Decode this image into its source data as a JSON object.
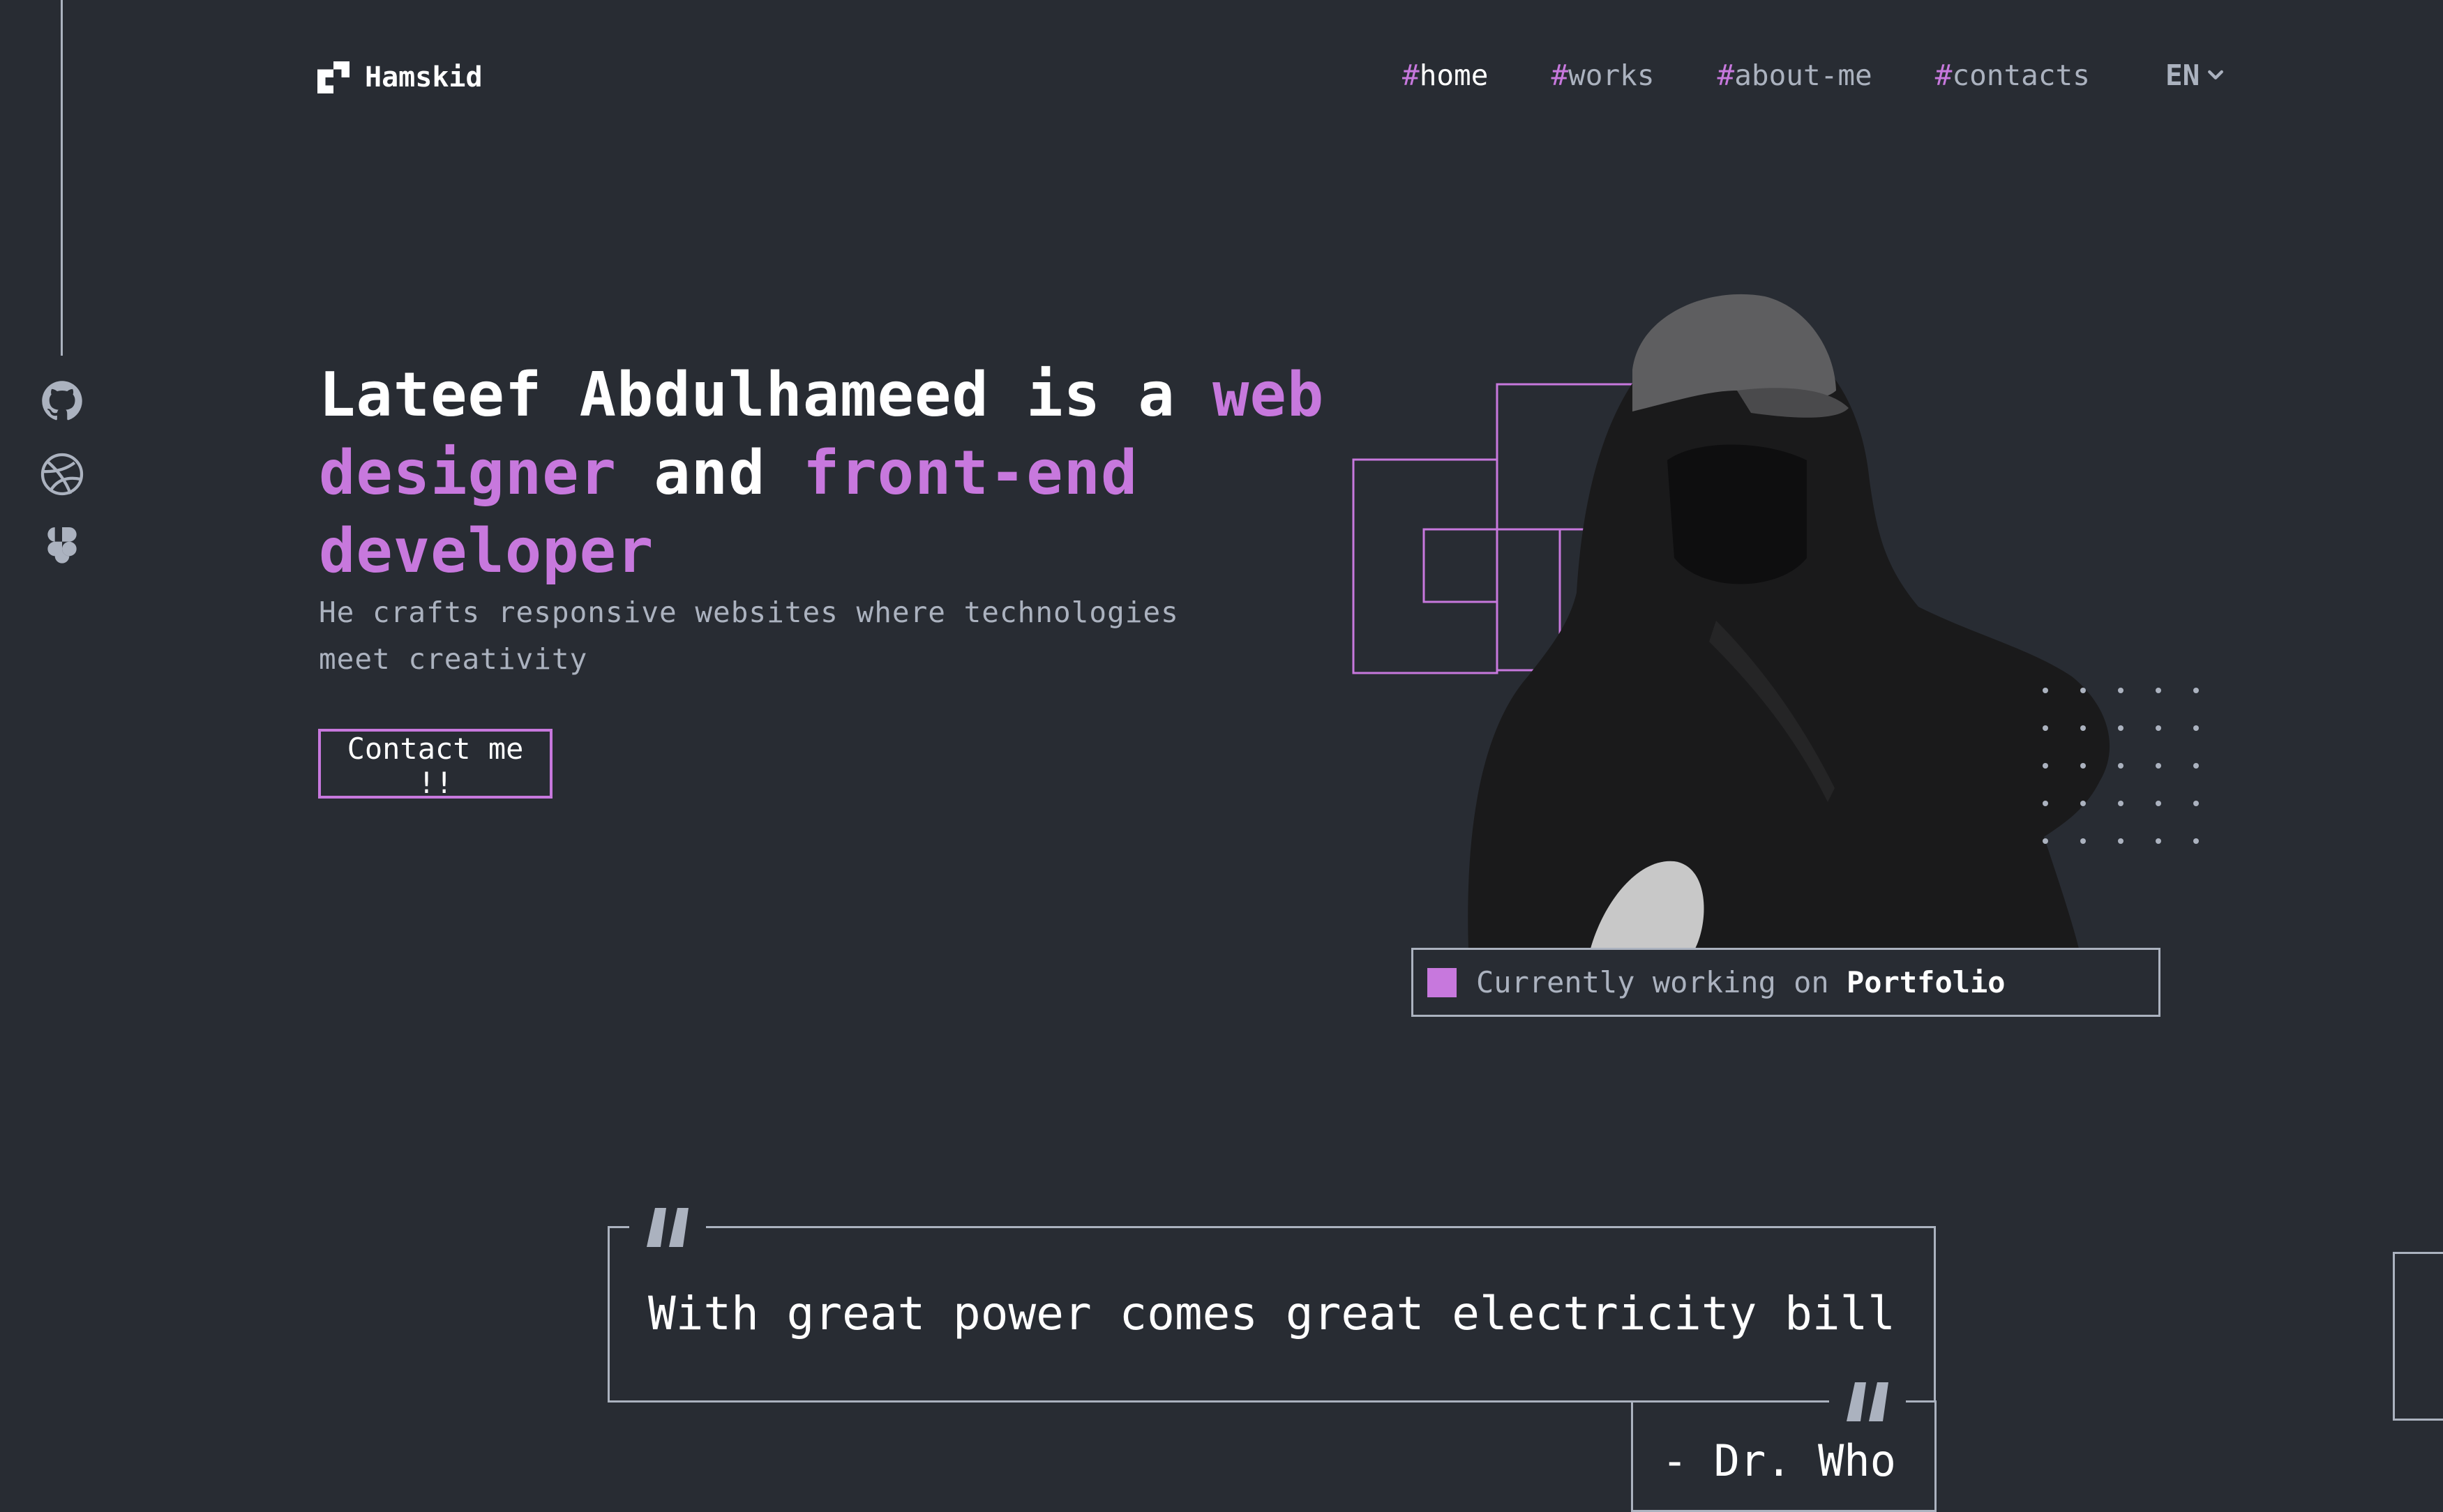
{
  "brand": {
    "name": "Hamskid"
  },
  "nav": {
    "items": [
      {
        "hash": "#",
        "label": "home",
        "active": true
      },
      {
        "hash": "#",
        "label": "works",
        "active": false
      },
      {
        "hash": "#",
        "label": "about-me",
        "active": false
      },
      {
        "hash": "#",
        "label": "contacts",
        "active": false
      }
    ],
    "language": "EN"
  },
  "social": [
    "github-icon",
    "dribbble-icon",
    "figma-icon"
  ],
  "hero": {
    "headline": {
      "p1": "Lateef Abdulhameed is a ",
      "p2": "web designer",
      "p3": " and ",
      "p4": "front-end developer"
    },
    "subline": "He crafts responsive websites where technologies meet creativity",
    "cta": "Contact me !!",
    "status": {
      "prefix": "Currently working on ",
      "project": "Portfolio"
    }
  },
  "quote": {
    "text": "With great power comes great electricity bill",
    "author": "- Dr. Who"
  },
  "colors": {
    "background": "#282c33",
    "accent": "#c778dd",
    "muted": "#abb2bf",
    "text": "#ffffff"
  }
}
